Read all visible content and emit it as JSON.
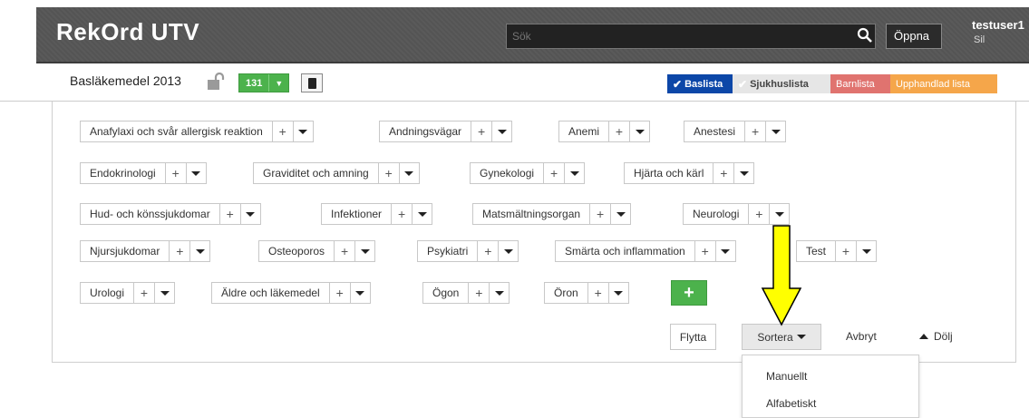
{
  "header": {
    "app_title": "RekOrd UTV",
    "search_placeholder": "Sök",
    "open_button": "Öppna",
    "user_name": "testuser1",
    "user_sub": "Sil"
  },
  "listbar": {
    "list_name": "Basläkemedel 2013",
    "count": "131",
    "tabs": [
      {
        "label": "Baslista",
        "checked": true,
        "color": "#0c47a8"
      },
      {
        "label": "Sjukhuslista",
        "checked": true,
        "color": "#e6e6e6"
      },
      {
        "label": "Barnlista",
        "checked": false,
        "color": "#e0736f"
      },
      {
        "label": "Upphandlad lista",
        "checked": false,
        "color": "#f5a64a"
      }
    ]
  },
  "categories": [
    "Anafylaxi och svår allergisk reaktion",
    "Andningsvägar",
    "Anemi",
    "Anestesi",
    "Endokrinologi",
    "Graviditet och amning",
    "Gynekologi",
    "Hjärta och kärl",
    "Hud- och könssjukdomar",
    "Infektioner",
    "Matsmältningsorgan",
    "Neurologi",
    "Njursjukdomar",
    "Osteoporos",
    "Psykiatri",
    "Smärta och inflammation",
    "Test",
    "Urologi",
    "Äldre och läkemedel",
    "Ögon",
    "Öron"
  ],
  "actions": {
    "move": "Flytta",
    "sort": "Sortera",
    "cancel": "Avbryt",
    "hide": "Dölj"
  },
  "sort_menu": {
    "options": [
      "Manuellt",
      "Alfabetiskt"
    ]
  },
  "colors": {
    "accent_green": "#4cb24c",
    "highlight_arrow": "#ffff00"
  }
}
